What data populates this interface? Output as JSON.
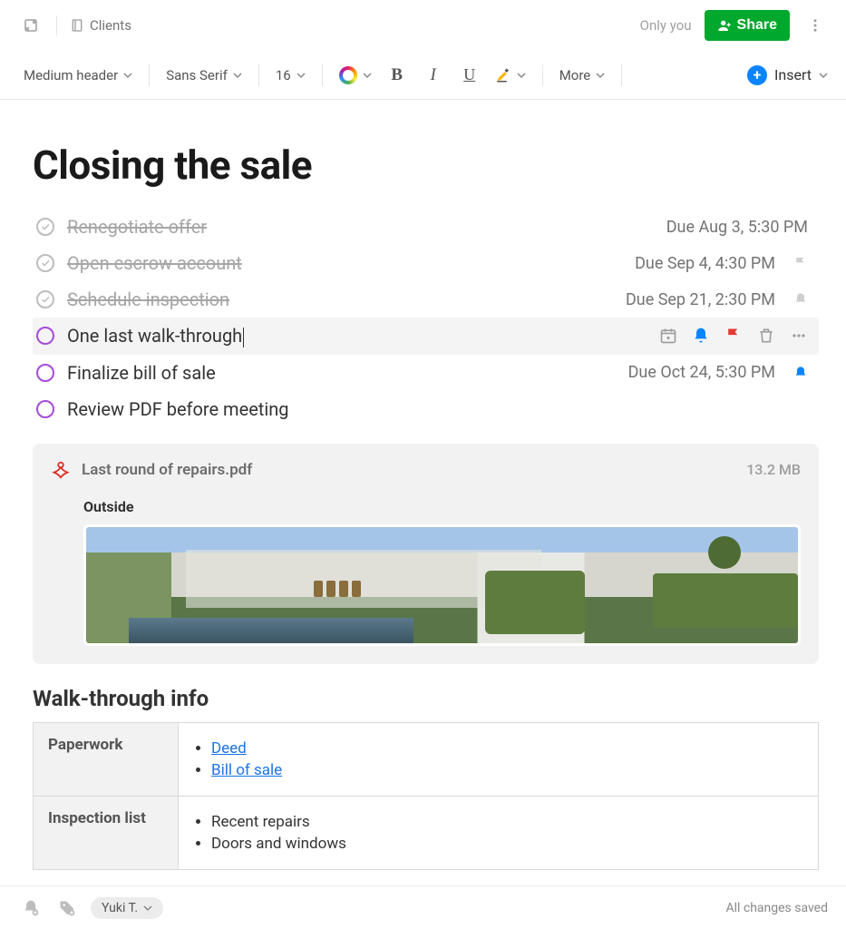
{
  "header": {
    "breadcrumb": "Clients",
    "visibility": "Only you",
    "share_label": "Share"
  },
  "toolbar": {
    "heading_style": "Medium header",
    "font_family": "Sans Serif",
    "font_size": "16",
    "more_label": "More",
    "insert_label": "Insert"
  },
  "document": {
    "title": "Closing the sale",
    "tasks": [
      {
        "label": "Renegotiate offer",
        "done": true,
        "due": "Due Aug 3, 5:30 PM",
        "trail": null
      },
      {
        "label": "Open escrow account",
        "done": true,
        "due": "Due Sep 4, 4:30 PM",
        "trail": "flag"
      },
      {
        "label": "Schedule inspection",
        "done": true,
        "due": "Due Sep 21, 2:30 PM",
        "trail": "bell"
      },
      {
        "label": "One last walk-through",
        "done": false,
        "active": true
      },
      {
        "label": "Finalize bill of sale",
        "done": false,
        "due": "Due Oct 24, 5:30 PM",
        "trail": "bell-blue"
      },
      {
        "label": "Review PDF before meeting",
        "done": false
      }
    ],
    "attachment": {
      "filename": "Last round of repairs.pdf",
      "filesize": "13.2 MB",
      "section_label": "Outside"
    },
    "section_heading": "Walk-through info",
    "table": {
      "rows": [
        {
          "header": "Paperwork",
          "items": [
            "Deed",
            "Bill of sale"
          ],
          "links": true
        },
        {
          "header": "Inspection list",
          "items": [
            "Recent repairs",
            "Doors and windows"
          ],
          "links": false
        }
      ]
    }
  },
  "statusbar": {
    "user": "Yuki T.",
    "save_status": "All changes saved"
  }
}
